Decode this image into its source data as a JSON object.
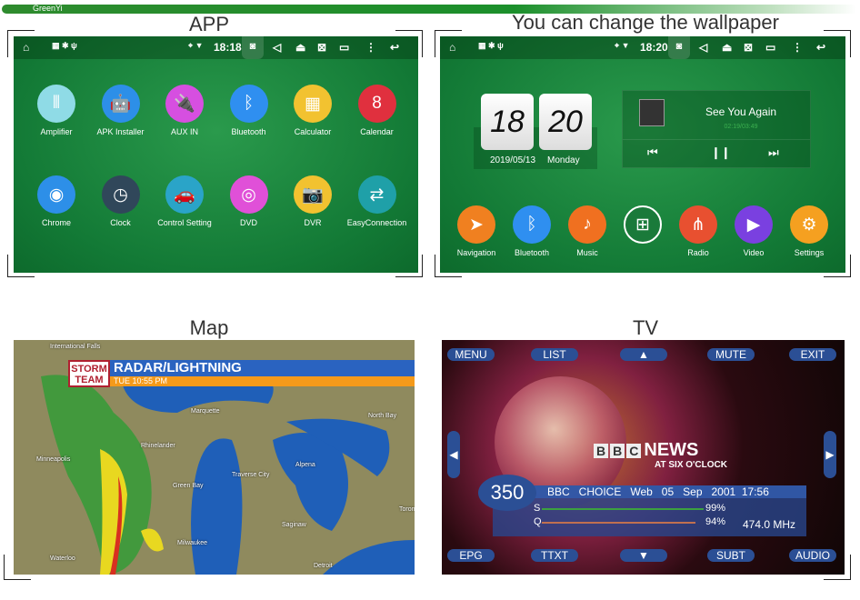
{
  "brand": "GreenYi",
  "panels": {
    "app": "APP",
    "wallpaper": "You can change the wallpaper",
    "map": "Map",
    "tv": "TV"
  },
  "status_app": {
    "time": "18:18"
  },
  "status_home": {
    "time": "18:20"
  },
  "apps": [
    {
      "label": "Amplifier",
      "color": "#8fdbe6",
      "icon": "equalizer-icon"
    },
    {
      "label": "APK Installer",
      "color": "#2d8fe8",
      "icon": "android-icon"
    },
    {
      "label": "AUX IN",
      "color": "#d64fe0",
      "icon": "plug-icon"
    },
    {
      "label": "Bluetooth",
      "color": "#2f8ff0",
      "icon": "bluetooth-icon"
    },
    {
      "label": "Calculator",
      "color": "#f2c230",
      "icon": "calculator-icon"
    },
    {
      "label": "Calendar",
      "color": "#e0303e",
      "icon": "calendar-icon"
    },
    {
      "label": "Chrome",
      "color": "#2d8fe8",
      "icon": "chrome-icon"
    },
    {
      "label": "Clock",
      "color": "#30475a",
      "icon": "clock-icon"
    },
    {
      "label": "Control Setting",
      "color": "#2aa4c8",
      "icon": "car-icon"
    },
    {
      "label": "DVD",
      "color": "#e050d8",
      "icon": "disc-icon"
    },
    {
      "label": "DVR",
      "color": "#f2c230",
      "icon": "camera-icon"
    },
    {
      "label": "EasyConnection",
      "color": "#1fa0a8",
      "icon": "connect-icon"
    }
  ],
  "clock": {
    "hour": "18",
    "minute": "20",
    "date": "2019/05/13",
    "day": "Monday"
  },
  "music": {
    "title": "See You Again",
    "progress": "02:19/03:49"
  },
  "dock": [
    {
      "label": "Navigation",
      "color": "#f08020",
      "icon": "compass-icon"
    },
    {
      "label": "Bluetooth",
      "color": "#2f8ff0",
      "icon": "bluetooth-icon"
    },
    {
      "label": "Music",
      "color": "#f07020",
      "icon": "music-icon"
    },
    {
      "label": "",
      "color": "#1a7a3a",
      "icon": "apps-grid-icon"
    },
    {
      "label": "Radio",
      "color": "#e85030",
      "icon": "radio-tower-icon"
    },
    {
      "label": "Video",
      "color": "#7a40e0",
      "icon": "play-icon"
    },
    {
      "label": "Settings",
      "color": "#f5a020",
      "icon": "gear-icon"
    }
  ],
  "map": {
    "badge1": "STORM",
    "badge2": "TEAM",
    "title": "RADAR/LIGHTNING",
    "time": "TUE   10:55 PM",
    "cities": [
      "International Falls",
      "Marquette",
      "North Bay",
      "Rhinelander",
      "Minneapolis",
      "Alpena",
      "Traverse City",
      "Green Bay",
      "Saginaw",
      "Milwaukee",
      "Waterloo",
      "Detroit",
      "Toron"
    ]
  },
  "tv": {
    "top": [
      "MENU",
      "LIST",
      "",
      "MUTE",
      "EXIT"
    ],
    "bottom": [
      "EPG",
      "TTXT",
      "",
      "SUBT",
      "AUDIO"
    ],
    "channel": "350",
    "info": "BBC   CHOICE   Web   05   Sep   2001  17:56",
    "s_label": "S",
    "s_value": "99%",
    "q_label": "Q",
    "q_value": "94%",
    "freq": "474.0 MHz",
    "logo": "NEWS",
    "logo_sub": "AT SIX O'CLOCK",
    "signal": 0.99,
    "quality": 0.94
  }
}
